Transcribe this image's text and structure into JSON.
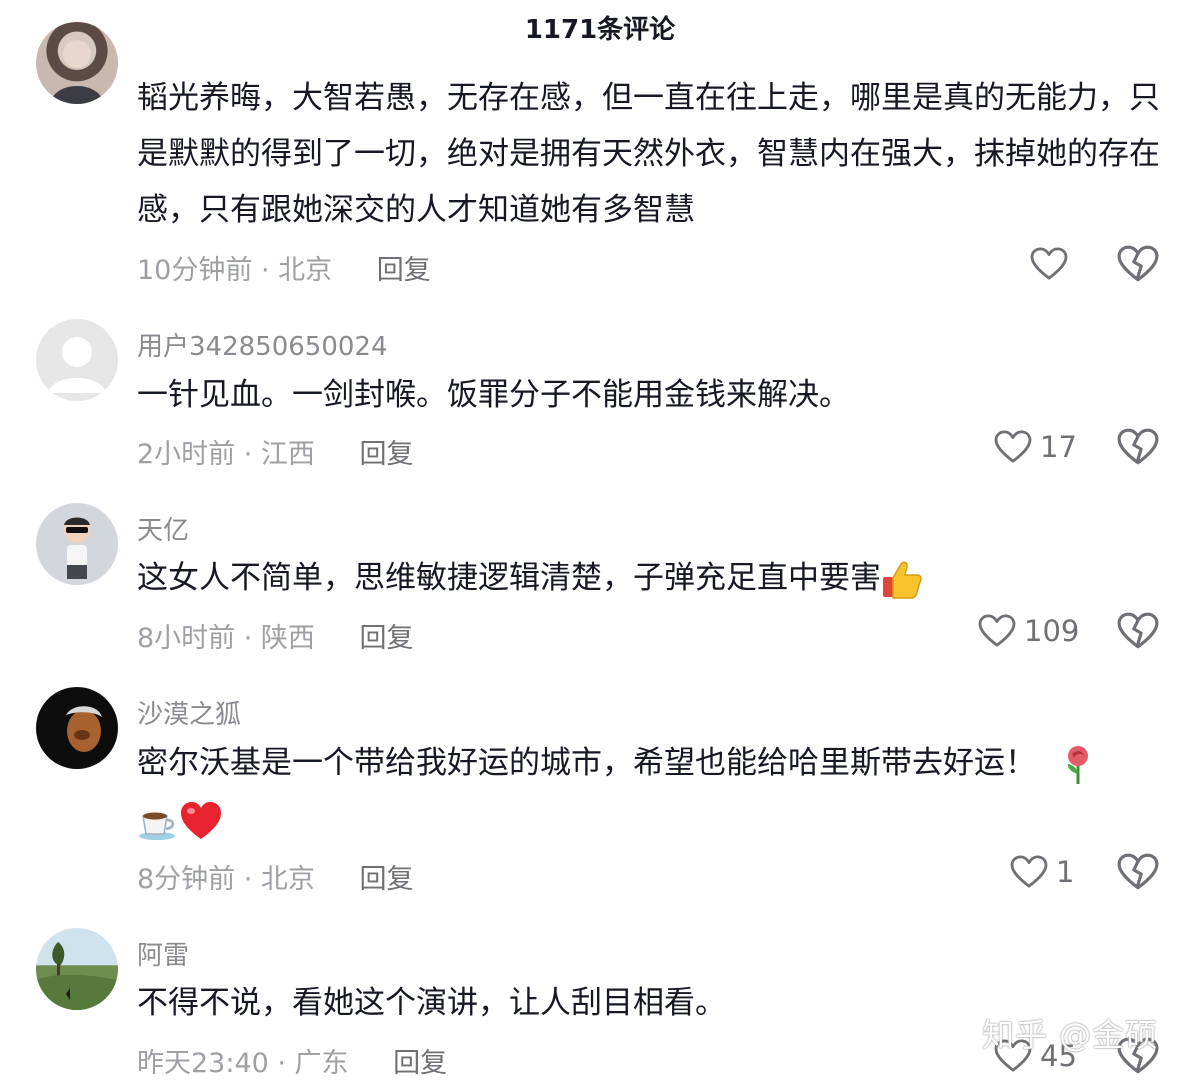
{
  "header": {
    "title": "1171条评论"
  },
  "comments": [
    {
      "username": "",
      "text": "韬光养晦，大智若愚，无存在感，但一直在往上走，哪里是真的无能力，只是默默的得到了一切，绝对是拥有天然外衣，智慧内在强大，抹掉她的存在感，只有跟她深交的人才知道她有多智慧",
      "time_location": "10分钟前 · 北京",
      "reply": "回复",
      "likes": ""
    },
    {
      "username": "用户342850650024",
      "text": "一针见血。一剑封喉。饭罪分子不能用金钱来解决。",
      "time_location": "2小时前 · 江西",
      "reply": "回复",
      "likes": "17"
    },
    {
      "username": "天亿",
      "text": "这女人不简单，思维敏捷逻辑清楚，子弹充足直中要害",
      "time_location": "8小时前 · 陕西",
      "reply": "回复",
      "likes": "109"
    },
    {
      "username": "沙漠之狐",
      "text": "密尔沃基是一个带给我好运的城市，希望也能给哈里斯带去好运！",
      "time_location": "8分钟前 · 北京",
      "reply": "回复",
      "likes": "1"
    },
    {
      "username": "阿雷",
      "text": "不得不说，看她这个演讲，让人刮目相看。",
      "time_location": "昨天23:40 · 广东",
      "reply": "回复",
      "likes": "45"
    }
  ],
  "watermark": "知乎 @金硕",
  "icons": {
    "like": "heart-outline-icon",
    "dislike": "broken-heart-outline-icon",
    "default_avatar": "default-user-avatar-icon",
    "thumbs_up": "thumbs-up-emoji",
    "rose": "rose-emoji",
    "coffee": "coffee-emoji",
    "heart": "red-heart-emoji"
  },
  "colors": {
    "text": "#161823",
    "meta": "#9ea0a6",
    "username": "#8a8b91",
    "heart_emoji": "#e8232f"
  }
}
